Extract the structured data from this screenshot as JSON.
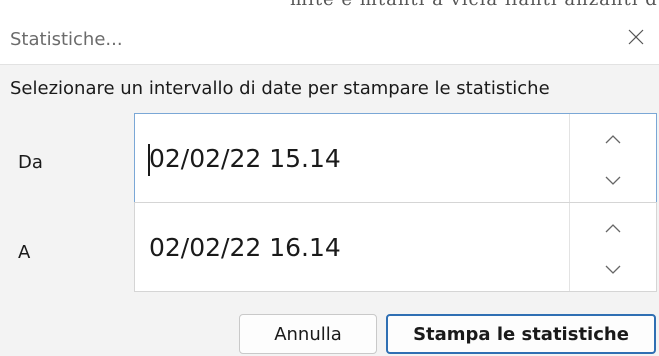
{
  "background": {
    "partial_text": "mite e mtanti a vicia ilanti anzanti d"
  },
  "dialog": {
    "title": "Statistiche...",
    "close_icon": "close-icon",
    "instruction": "Selezionare un intervallo di date per stampare le statistiche",
    "from": {
      "label": "Da",
      "value": "02/02/22 15.14",
      "focused": true
    },
    "to": {
      "label": "A",
      "value": "02/02/22 16.14",
      "focused": false
    },
    "buttons": {
      "cancel": "Annulla",
      "print": "Stampa le statistiche"
    },
    "colors": {
      "accent": "#2f6fb3",
      "focus_border": "#7aa7d6",
      "background": "#f3f3f3"
    }
  }
}
